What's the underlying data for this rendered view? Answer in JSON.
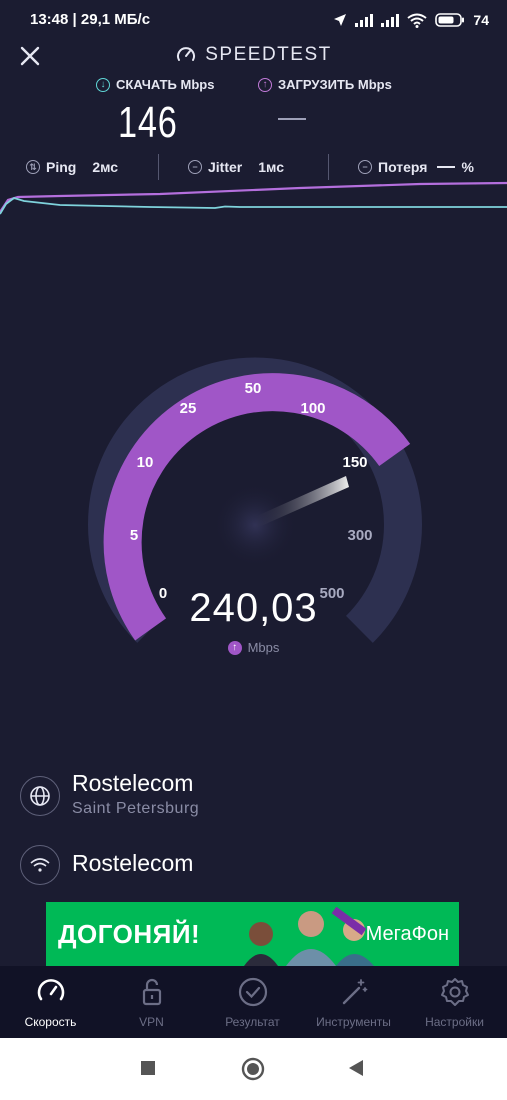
{
  "status_bar": {
    "time": "13:48 | 29,1 МБ/с",
    "battery": "74"
  },
  "header": {
    "title": "SPEEDTEST"
  },
  "metrics": {
    "download_label": "СКАЧАТЬ Mbps",
    "download_value": "146",
    "upload_label": "ЗАГРУЗИТЬ Mbps"
  },
  "stats": {
    "ping_label": "Ping",
    "ping_value": "2мс",
    "jitter_label": "Jitter",
    "jitter_value": "1мс",
    "loss_label": "Потеря",
    "loss_unit": "%"
  },
  "gauge": {
    "ticks": [
      "0",
      "5",
      "10",
      "25",
      "50",
      "100",
      "150",
      "300",
      "500"
    ],
    "value": "240,03",
    "unit": "Mbps"
  },
  "server": {
    "provider": "Rostelecom",
    "location": "Saint Petersburg",
    "network": "Rostelecom"
  },
  "ad": {
    "headline": "ДОГОНЯЙ!",
    "brand": "МегаФон"
  },
  "bottom_nav": {
    "items": [
      {
        "label": "Скорость"
      },
      {
        "label": "VPN"
      },
      {
        "label": "Результат"
      },
      {
        "label": "Инструменты"
      },
      {
        "label": "Настройки"
      }
    ]
  },
  "colors": {
    "background": "#1b1c31",
    "download_accent": "#5fd6d6",
    "upload_accent": "#c17ad8",
    "gauge_purple": "#a056c7",
    "ad_green": "#00b956"
  }
}
